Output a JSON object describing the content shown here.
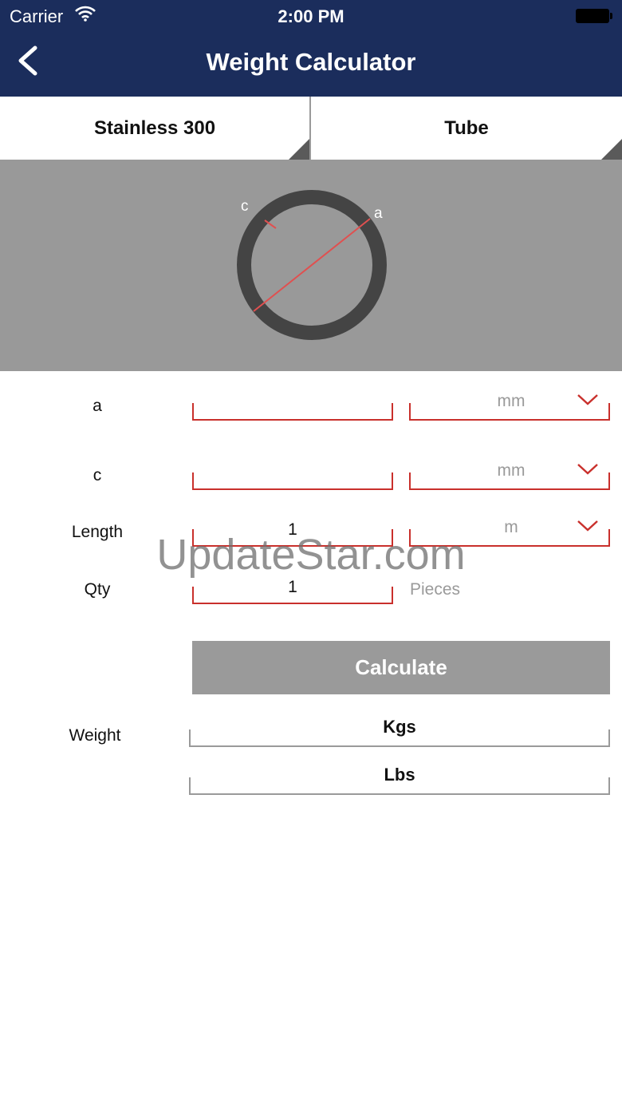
{
  "status_bar": {
    "carrier": "Carrier",
    "time": "2:00 PM"
  },
  "nav": {
    "title": "Weight Calculator"
  },
  "selectors": {
    "material": "Stainless 300",
    "shape": "Tube"
  },
  "diagram": {
    "label_a": "a",
    "label_c": "c"
  },
  "inputs": {
    "a": {
      "label": "a",
      "value": "",
      "unit": "mm"
    },
    "c": {
      "label": "c",
      "value": "",
      "unit": "mm"
    },
    "length": {
      "label": "Length",
      "value": "1",
      "unit": "m"
    },
    "qty": {
      "label": "Qty",
      "value": "1",
      "unit": "Pieces"
    }
  },
  "calculate_label": "Calculate",
  "results": {
    "label": "Weight",
    "kgs": "Kgs",
    "lbs": "Lbs"
  },
  "watermark": "UpdateStar.com",
  "colors": {
    "nav_bg": "#1b2d5c",
    "accent_red": "#c9302c",
    "diagram_bg": "#999999",
    "ring": "#444444",
    "button_bg": "#9a9a9a"
  }
}
